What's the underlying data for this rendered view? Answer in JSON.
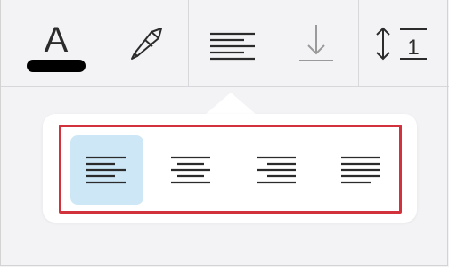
{
  "toolbar": {
    "buttons": [
      {
        "name": "text-color",
        "icon": "text-color-icon",
        "glyph": "A",
        "color_swatch": "#000000"
      },
      {
        "name": "highlighter",
        "icon": "highlighter-icon"
      },
      {
        "name": "paragraph-alignment",
        "icon": "align-left-icon"
      },
      {
        "name": "vertical-alignment",
        "icon": "align-bottom-icon"
      },
      {
        "name": "line-spacing",
        "icon": "line-spacing-icon",
        "glyph": "1"
      }
    ]
  },
  "alignment_popover": {
    "options": [
      {
        "name": "align-left",
        "icon": "align-left-icon",
        "selected": true
      },
      {
        "name": "align-center",
        "icon": "align-center-icon",
        "selected": false
      },
      {
        "name": "align-right",
        "icon": "align-right-icon",
        "selected": false
      },
      {
        "name": "justify",
        "icon": "align-justify-icon",
        "selected": false
      }
    ]
  },
  "colors": {
    "selected_background": "#cde7f7",
    "highlight_border": "#d2323c",
    "icon_dark": "#2b2b2b",
    "icon_light": "#9a9a9a"
  }
}
